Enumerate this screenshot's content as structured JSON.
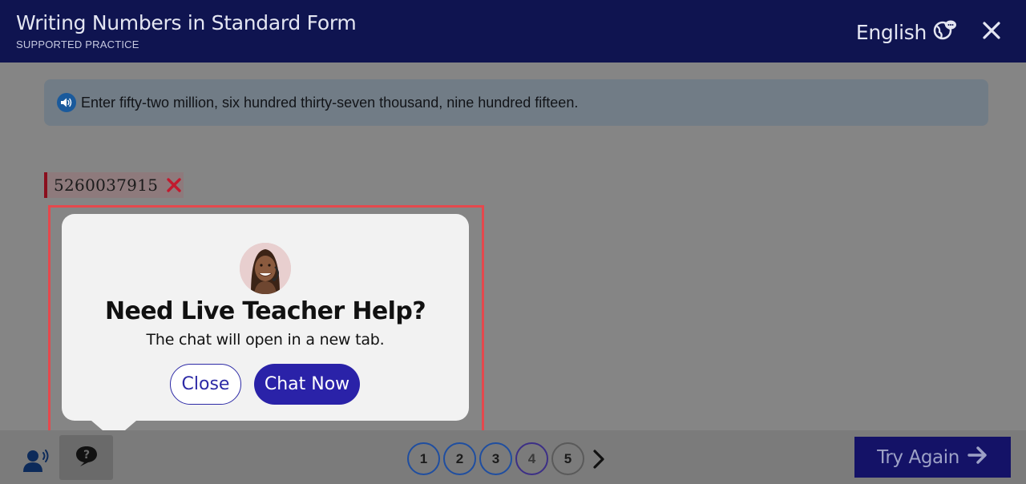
{
  "header": {
    "title": "Writing Numbers in Standard Form",
    "subtitle": "SUPPORTED PRACTICE",
    "language": "English"
  },
  "prompt": {
    "text": "Enter fifty-two million, six hundred thirty-seven thousand, nine hundred fifteen."
  },
  "answer": {
    "value": "5260037915",
    "status": "incorrect"
  },
  "popup": {
    "heading": "Need Live Teacher Help?",
    "subtext": "The chat will open in a new tab.",
    "close_label": "Close",
    "chat_label": "Chat Now"
  },
  "pager": {
    "pages": [
      "1",
      "2",
      "3",
      "4",
      "5"
    ],
    "current": "4"
  },
  "footer": {
    "try_again_label": "Try Again"
  },
  "colors": {
    "header_bg": "#0f1450",
    "chat_button": "#2a22a8",
    "error": "#c21a2e",
    "try_again_bg": "#141267"
  }
}
